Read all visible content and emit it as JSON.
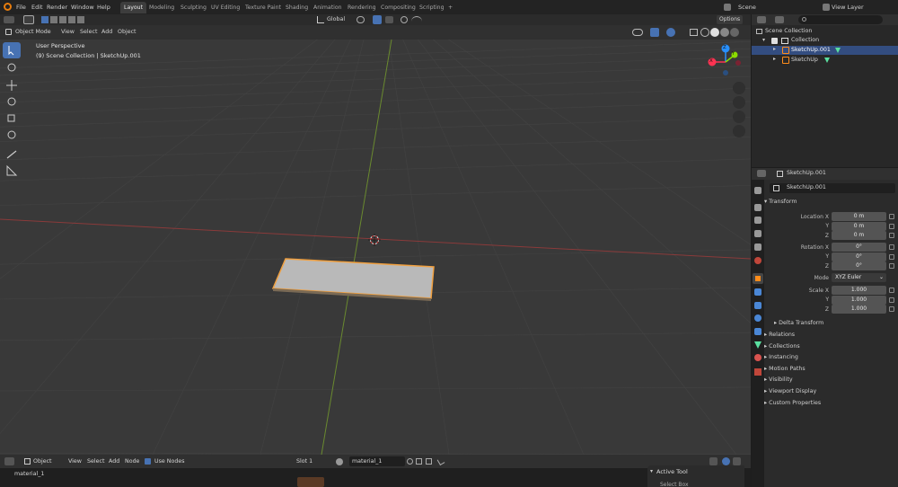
{
  "menus": [
    "File",
    "Edit",
    "Render",
    "Window",
    "Help"
  ],
  "workspaces": [
    "Layout",
    "Modeling",
    "Sculpting",
    "UV Editing",
    "Texture Paint",
    "Shading",
    "Animation",
    "Rendering",
    "Compositing",
    "Scripting",
    "+"
  ],
  "active_workspace": "Layout",
  "scene": "Scene",
  "view_layer": "View Layer",
  "viewport": {
    "mode": "Object Mode",
    "menu": [
      "View",
      "Select",
      "Add",
      "Object"
    ],
    "orientation": "Global",
    "options": "Options",
    "overlay_line1": "User Perspective",
    "overlay_line2": "(9) Scene Collection | SketchUp.001",
    "gizmo": {
      "x": "X",
      "y": "Y",
      "z": "Z"
    }
  },
  "outliner": {
    "root": "Scene Collection",
    "collection": "Collection",
    "items": [
      "SketchUp.001",
      "SketchUp"
    ]
  },
  "properties": {
    "object_name": "SketchUp.001",
    "datablock_name": "SketchUp.001",
    "transform_title": "Transform",
    "location_label": "Location X",
    "rotation_label": "Rotation X",
    "scale_label": "Scale X",
    "y": "Y",
    "z": "Z",
    "location": [
      "0 m",
      "0 m",
      "0 m"
    ],
    "rotation": [
      "0°",
      "0°",
      "0°"
    ],
    "mode_label": "Mode",
    "mode_value": "XYZ Euler",
    "scale": [
      "1.000",
      "1.000",
      "1.000"
    ],
    "delta": "Delta Transform",
    "panels": [
      "Relations",
      "Collections",
      "Instancing",
      "Motion Paths",
      "Visibility",
      "Viewport Display",
      "Custom Properties"
    ]
  },
  "shader": {
    "mode": "Object",
    "menu": [
      "View",
      "Select",
      "Add",
      "Node"
    ],
    "use_nodes": "Use Nodes",
    "slot": "Slot 1",
    "material": "material_1",
    "breadcrumb": "material_1",
    "active_tool": "Active Tool",
    "active_tool_sub": "Select Box"
  },
  "colors": {
    "accent": "#4772b3",
    "selection": "#ff8c1a",
    "x_axis": "#ff3352",
    "y_axis": "#8bdc00",
    "z_axis": "#2890ff"
  }
}
